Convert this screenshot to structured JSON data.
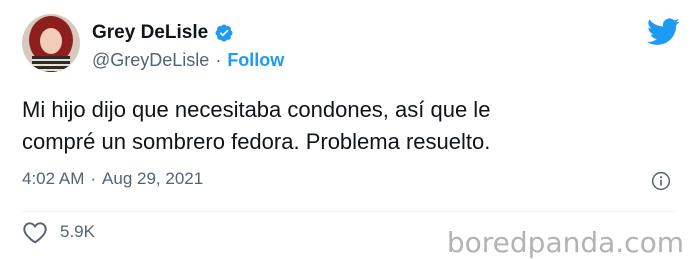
{
  "author": {
    "name": "Grey DeLisle",
    "handle": "@GreyDeLisle",
    "separator": "·",
    "follow_label": "Follow",
    "verified": true
  },
  "tweet": {
    "text": "Mi hijo dijo que necesitaba condones, así que le\ncompré un sombrero fedora. Problema resuelto.",
    "time": "4:02 AM",
    "separator": "·",
    "date": "Aug 29, 2021"
  },
  "engagement": {
    "likes": "5.9K"
  },
  "watermark": "boredpanda.com",
  "icons": {
    "brand": "twitter-bird-icon",
    "verified": "verified-badge-icon",
    "info": "info-icon",
    "like": "heart-icon"
  },
  "colors": {
    "accent": "#1d9bf0",
    "text": "#0f1419",
    "muted": "#536471"
  }
}
